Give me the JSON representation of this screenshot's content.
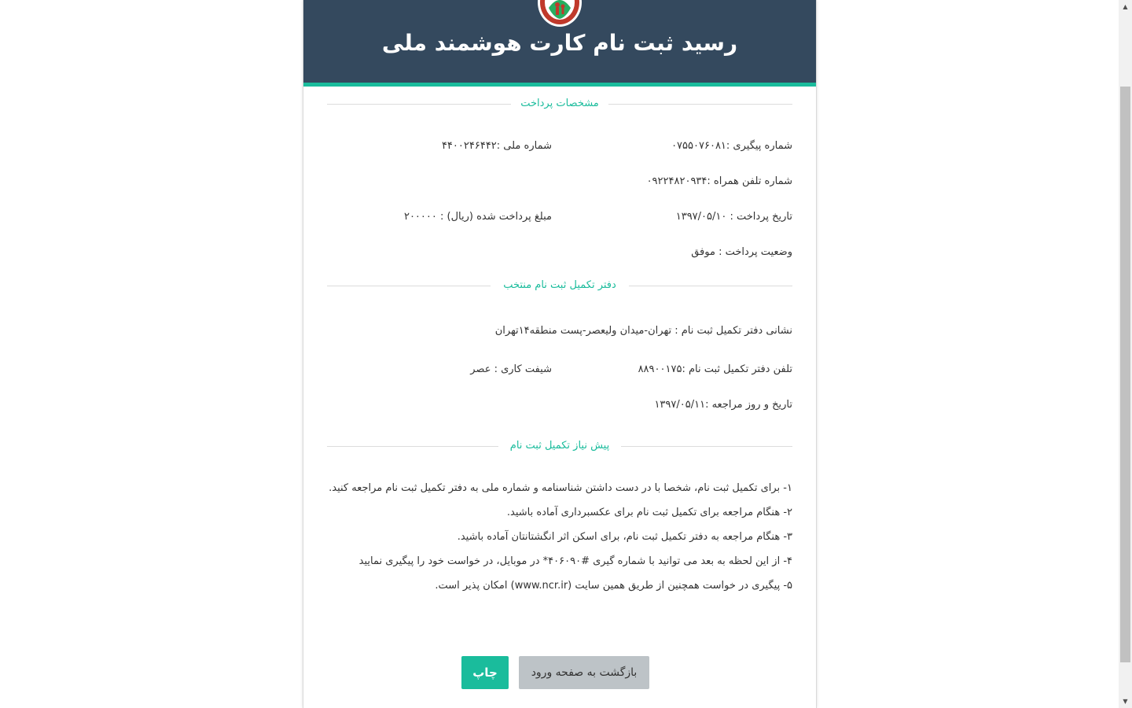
{
  "header": {
    "title": "رسید ثبت نام کارت هوشمند ملی"
  },
  "payment_section": {
    "heading": "مشخصات پرداخت",
    "tracking_number": "شماره پیگیری :۰۷۵۵۰۷۶۰۸۱",
    "national_id": "شماره ملی :۴۴۰۰۲۴۶۴۴۲",
    "mobile": "شماره تلفن همراه :۰۹۲۲۴۸۲۰۹۳۴",
    "payment_date": "تاریخ پرداخت : ۱۳۹۷/۰۵/۱۰",
    "amount": "مبلغ پرداخت شده (ریال) : ۲۰۰۰۰۰",
    "status": "وضعیت پرداخت : موفق"
  },
  "office_section": {
    "heading": "دفتر تکمیل ثبت نام منتخب",
    "address": "نشانی دفتر تکمیل ثبت نام : تهران-میدان ولیعصر-پست منطقه۱۴تهران",
    "phone": "تلفن دفتر تکمیل ثبت نام :۸۸۹۰۰۱۷۵",
    "shift": "شیفت کاری : عصر",
    "visit_date": "تاریخ و روز مراجعه :۱۳۹۷/۰۵/۱۱"
  },
  "prereq_section": {
    "heading": "پیش نیاز تکمیل ثبت نام",
    "items": [
      "۱- برای تکمیل ثبت نام، شخصا با در دست داشتن شناسنامه و شماره ملی به دفتر تکمیل ثبت نام مراجعه کنید.",
      "۲- هنگام مراجعه برای تکمیل ثبت نام برای عکسبرداری آماده باشید.",
      "۳- هنگام مراجعه به دفتر تکمیل ثبت نام، برای اسکن اثر انگشتانتان آماده باشید.",
      "۴- از این لحظه به بعد می توانید با شماره گیری #۴۰۶۰۹۰* در موبایل، در خواست خود را پیگیری نمایید",
      "۵- پیگیری در خواست همچنین از طریق همین سایت (www.ncr.ir) امکان پذیر است."
    ]
  },
  "buttons": {
    "print": "چاپ",
    "back": "بازگشت به صفحه ورود"
  },
  "colors": {
    "header_bg": "#34495e",
    "accent": "#1abc9c",
    "secondary_button": "#bdc3c7"
  }
}
